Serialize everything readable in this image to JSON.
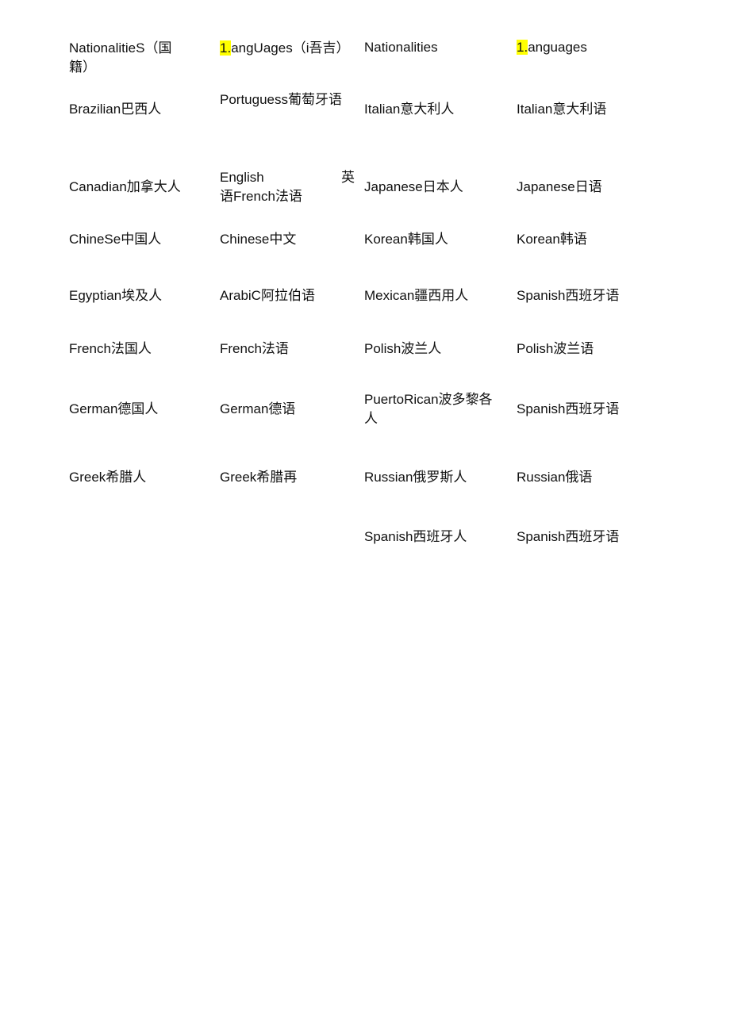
{
  "highlight_color": "#ffff00",
  "header": {
    "col0": "NationalitieS（国籍）",
    "col1_prefix": "1.",
    "col1_rest": "angUages（i吾吉）",
    "col2": "Nationalities",
    "col3_prefix": "1.",
    "col3_rest": "anguages"
  },
  "rows": [
    {
      "nationality": "Brazilian巴西人",
      "language": "Portuguess葡萄牙语",
      "nationality2": "Italian意大利人",
      "language2": "Italian意大利语"
    },
    {
      "nationality": "Canadian加拿大人",
      "language_line1_left": "English",
      "language_line1_right": "英",
      "language_line2": "语French法语",
      "nationality2": "Japanese日本人",
      "language2": "Japanese日语"
    },
    {
      "nationality": "ChineSe中国人",
      "language": "Chinese中文",
      "nationality2": "Korean韩国人",
      "language2": "Korean韩语"
    },
    {
      "nationality": "Egyptian埃及人",
      "language": "ArabiC阿拉伯语",
      "nationality2": "Mexican疆西用人",
      "language2": "Spanish西班牙语"
    },
    {
      "nationality": "French法国人",
      "language": "French法语",
      "nationality2": "Polish波兰人",
      "language2": "Polish波兰语"
    },
    {
      "nationality": "German德国人",
      "language": "German德语",
      "nationality2": "PuertoRican波多黎各人",
      "language2": "Spanish西班牙语"
    },
    {
      "nationality": "Greek希腊人",
      "language": "Greek希腊再",
      "nationality2": "Russian俄罗斯人",
      "language2": "Russian俄语"
    },
    {
      "nationality": "",
      "language": "",
      "nationality2": "Spanish西班牙人",
      "language2": "Spanish西班牙语"
    }
  ]
}
